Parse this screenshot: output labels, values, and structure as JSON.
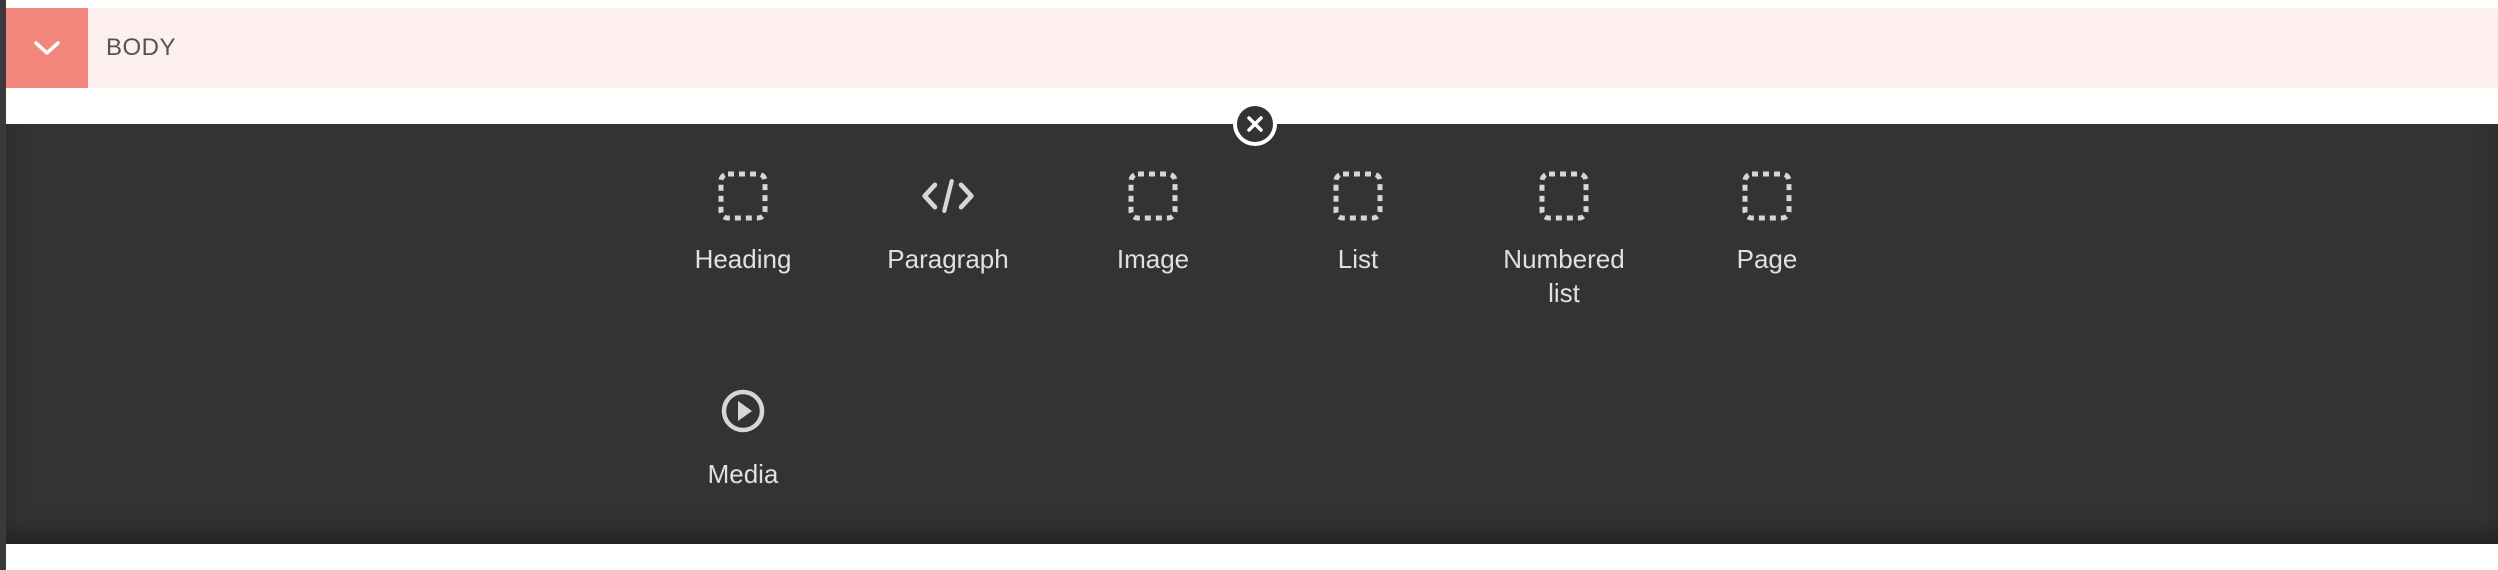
{
  "section": {
    "title": "BODY",
    "toggle_icon": "chevron-down-icon",
    "accent_color": "#f3877e",
    "background_color": "#fcefee"
  },
  "panel": {
    "background_color": "#333333",
    "close_icon": "close-icon",
    "blocks": [
      {
        "label": "Heading",
        "icon": "dashed-square-icon"
      },
      {
        "label": "Paragraph",
        "icon": "code-icon"
      },
      {
        "label": "Image",
        "icon": "dashed-square-icon"
      },
      {
        "label": "List",
        "icon": "dashed-square-icon"
      },
      {
        "label": "Numbered list",
        "icon": "dashed-square-icon"
      },
      {
        "label": "Page",
        "icon": "dashed-square-icon"
      },
      {
        "label": "Media",
        "icon": "play-circle-icon"
      }
    ]
  }
}
